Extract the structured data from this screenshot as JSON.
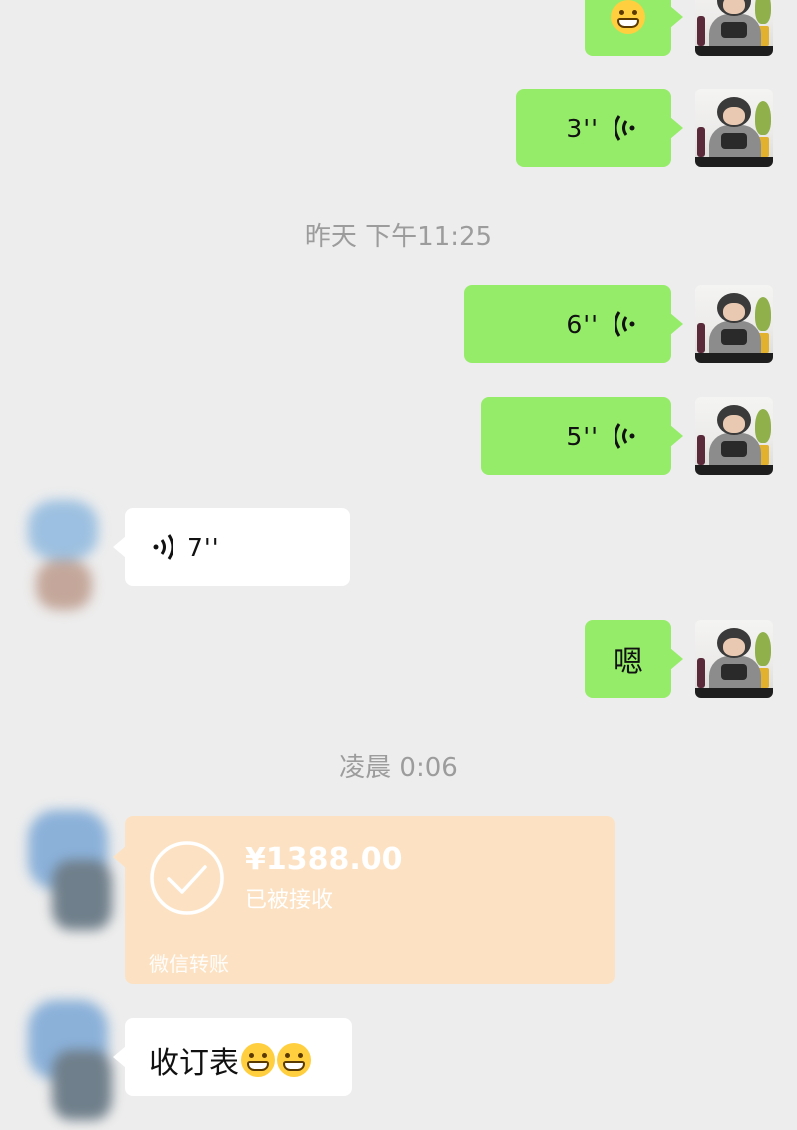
{
  "messages": {
    "m1": {
      "type": "emoji"
    },
    "m2": {
      "duration": "3''"
    },
    "time1": "昨天 下午11:25",
    "m3": {
      "duration": "6''"
    },
    "m4": {
      "duration": "5''"
    },
    "m5": {
      "duration": "7''"
    },
    "m6": {
      "text": "嗯"
    },
    "time2": "凌晨 0:06",
    "transfer": {
      "amount": "¥1388.00",
      "status": "已被接收",
      "footer": "微信转账"
    },
    "m7": {
      "text": "收订表"
    }
  },
  "colors": {
    "background": "#ededed",
    "my_bubble": "#95ec69",
    "other_bubble": "#ffffff",
    "transfer_card": "#fce2c3",
    "timestamp": "#9c9c9c"
  }
}
